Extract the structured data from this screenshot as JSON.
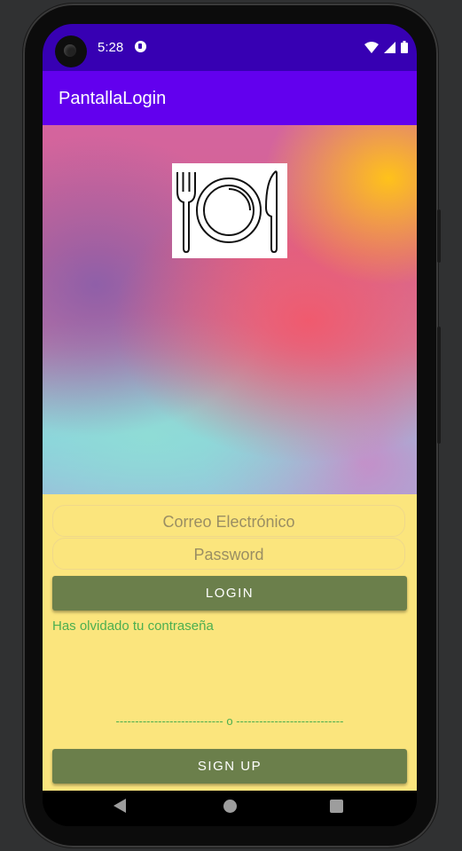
{
  "status_bar": {
    "time": "5:28"
  },
  "app_bar": {
    "title": "PantallaLogin"
  },
  "login_form": {
    "email_placeholder": "Correo Electrónico",
    "password_placeholder": "Password",
    "login_label": "LOGIN",
    "forgot_label": "Has olvidado tu contraseña",
    "divider_text": "---------------------------- o ----------------------------",
    "signup_label": "SIGN UP"
  },
  "colors": {
    "status_bar": "#3700b3",
    "app_bar": "#6200ee",
    "form_background": "#fbe57d",
    "button": "#6b7f4b",
    "link_text": "#4caf50"
  },
  "icons": [
    "fork-plate-knife-icon",
    "wifi-icon",
    "signal-icon",
    "battery-icon",
    "nav-back-icon",
    "nav-home-icon",
    "nav-recents-icon"
  ]
}
